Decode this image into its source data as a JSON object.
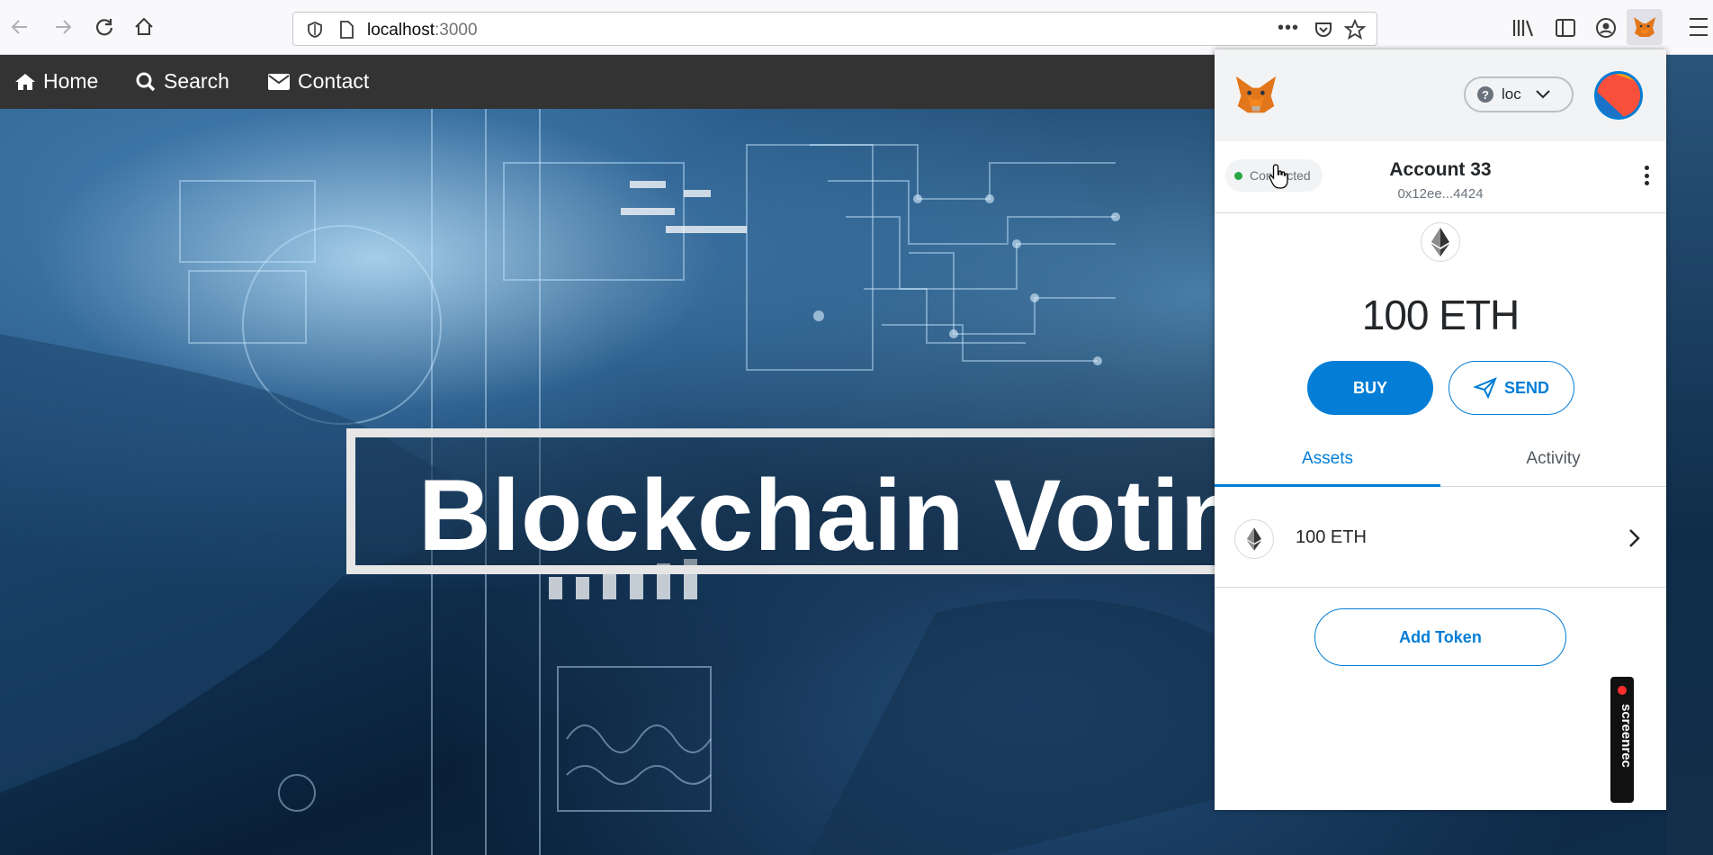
{
  "browser": {
    "url_host": "localhost",
    "url_port": ":3000"
  },
  "navbar": {
    "items": [
      {
        "label": "Home",
        "icon": "home-icon"
      },
      {
        "label": "Search",
        "icon": "search-icon"
      },
      {
        "label": "Contact",
        "icon": "envelope-icon"
      }
    ]
  },
  "hero": {
    "title": "Blockchain Votin"
  },
  "metamask": {
    "network_label": "loc",
    "connection_status": "Connected",
    "account_name": "Account 33",
    "account_address": "0x12ee...4424",
    "balance": "100 ETH",
    "buy_label": "BUY",
    "send_label": "SEND",
    "tabs": [
      {
        "label": "Assets",
        "active": true
      },
      {
        "label": "Activity",
        "active": false
      }
    ],
    "assets": [
      {
        "label": "100 ETH",
        "icon": "ethereum-icon"
      }
    ],
    "add_token_label": "Add Token",
    "accent_color": "#037dd6"
  },
  "watermark": {
    "text": "screenrec"
  }
}
